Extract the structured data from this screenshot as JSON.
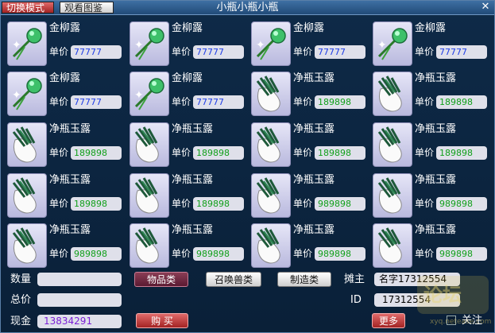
{
  "window": {
    "title": "小瓶小瓶小瓶",
    "switch_mode_label": "切换模式",
    "view_gallery_label": "观看图鉴"
  },
  "items": [
    {
      "name": "金柳露",
      "price_label": "单价",
      "price": "77777",
      "type": "jinliulu",
      "price_color": "#1f3de6"
    },
    {
      "name": "金柳露",
      "price_label": "单价",
      "price": "77777",
      "type": "jinliulu",
      "price_color": "#1f3de6"
    },
    {
      "name": "金柳露",
      "price_label": "单价",
      "price": "77777",
      "type": "jinliulu",
      "price_color": "#1f3de6"
    },
    {
      "name": "金柳露",
      "price_label": "单价",
      "price": "77777",
      "type": "jinliulu",
      "price_color": "#1f3de6"
    },
    {
      "name": "金柳露",
      "price_label": "单价",
      "price": "77777",
      "type": "jinliulu",
      "price_color": "#1f3de6"
    },
    {
      "name": "金柳露",
      "price_label": "单价",
      "price": "77777",
      "type": "jinliulu",
      "price_color": "#1f3de6"
    },
    {
      "name": "净瓶玉露",
      "price_label": "单价",
      "price": "189898",
      "type": "jingping",
      "price_color": "#11a01a"
    },
    {
      "name": "净瓶玉露",
      "price_label": "单价",
      "price": "189898",
      "type": "jingping",
      "price_color": "#11a01a"
    },
    {
      "name": "净瓶玉露",
      "price_label": "单价",
      "price": "189898",
      "type": "jingping",
      "price_color": "#11a01a"
    },
    {
      "name": "净瓶玉露",
      "price_label": "单价",
      "price": "189898",
      "type": "jingping",
      "price_color": "#11a01a"
    },
    {
      "name": "净瓶玉露",
      "price_label": "单价",
      "price": "189898",
      "type": "jingping",
      "price_color": "#11a01a"
    },
    {
      "name": "净瓶玉露",
      "price_label": "单价",
      "price": "189898",
      "type": "jingping",
      "price_color": "#11a01a"
    },
    {
      "name": "净瓶玉露",
      "price_label": "单价",
      "price": "189898",
      "type": "jingping",
      "price_color": "#11a01a"
    },
    {
      "name": "净瓶玉露",
      "price_label": "单价",
      "price": "189898",
      "type": "jingping",
      "price_color": "#11a01a"
    },
    {
      "name": "净瓶玉露",
      "price_label": "单价",
      "price": "989898",
      "type": "jingping",
      "price_color": "#11a01a"
    },
    {
      "name": "净瓶玉露",
      "price_label": "单价",
      "price": "989898",
      "type": "jingping",
      "price_color": "#11a01a"
    },
    {
      "name": "净瓶玉露",
      "price_label": "单价",
      "price": "989898",
      "type": "jingping",
      "price_color": "#11a01a"
    },
    {
      "name": "净瓶玉露",
      "price_label": "单价",
      "price": "989898",
      "type": "jingping",
      "price_color": "#11a01a"
    },
    {
      "name": "净瓶玉露",
      "price_label": "单价",
      "price": "989898",
      "type": "jingping",
      "price_color": "#11a01a"
    },
    {
      "name": "净瓶玉露",
      "price_label": "单价",
      "price": "989898",
      "type": "jingping",
      "price_color": "#11a01a"
    }
  ],
  "bottom": {
    "quantity_label": "数量",
    "quantity_value": "",
    "total_label": "总价",
    "total_value": "",
    "cash_label": "现金",
    "cash_value": "13834291",
    "cash_color": "#7a1fd6",
    "category_items": "物品类",
    "category_pets": "召唤兽类",
    "category_make": "制造类",
    "buy_label": "购 买",
    "stall_owner_label": "摊主",
    "stall_owner_value": "名字17312554",
    "id_label": "ID",
    "id_value": "17312554",
    "more_label": "更多",
    "watch_label": "关注",
    "watermark_url": "xyq.netease.com"
  }
}
